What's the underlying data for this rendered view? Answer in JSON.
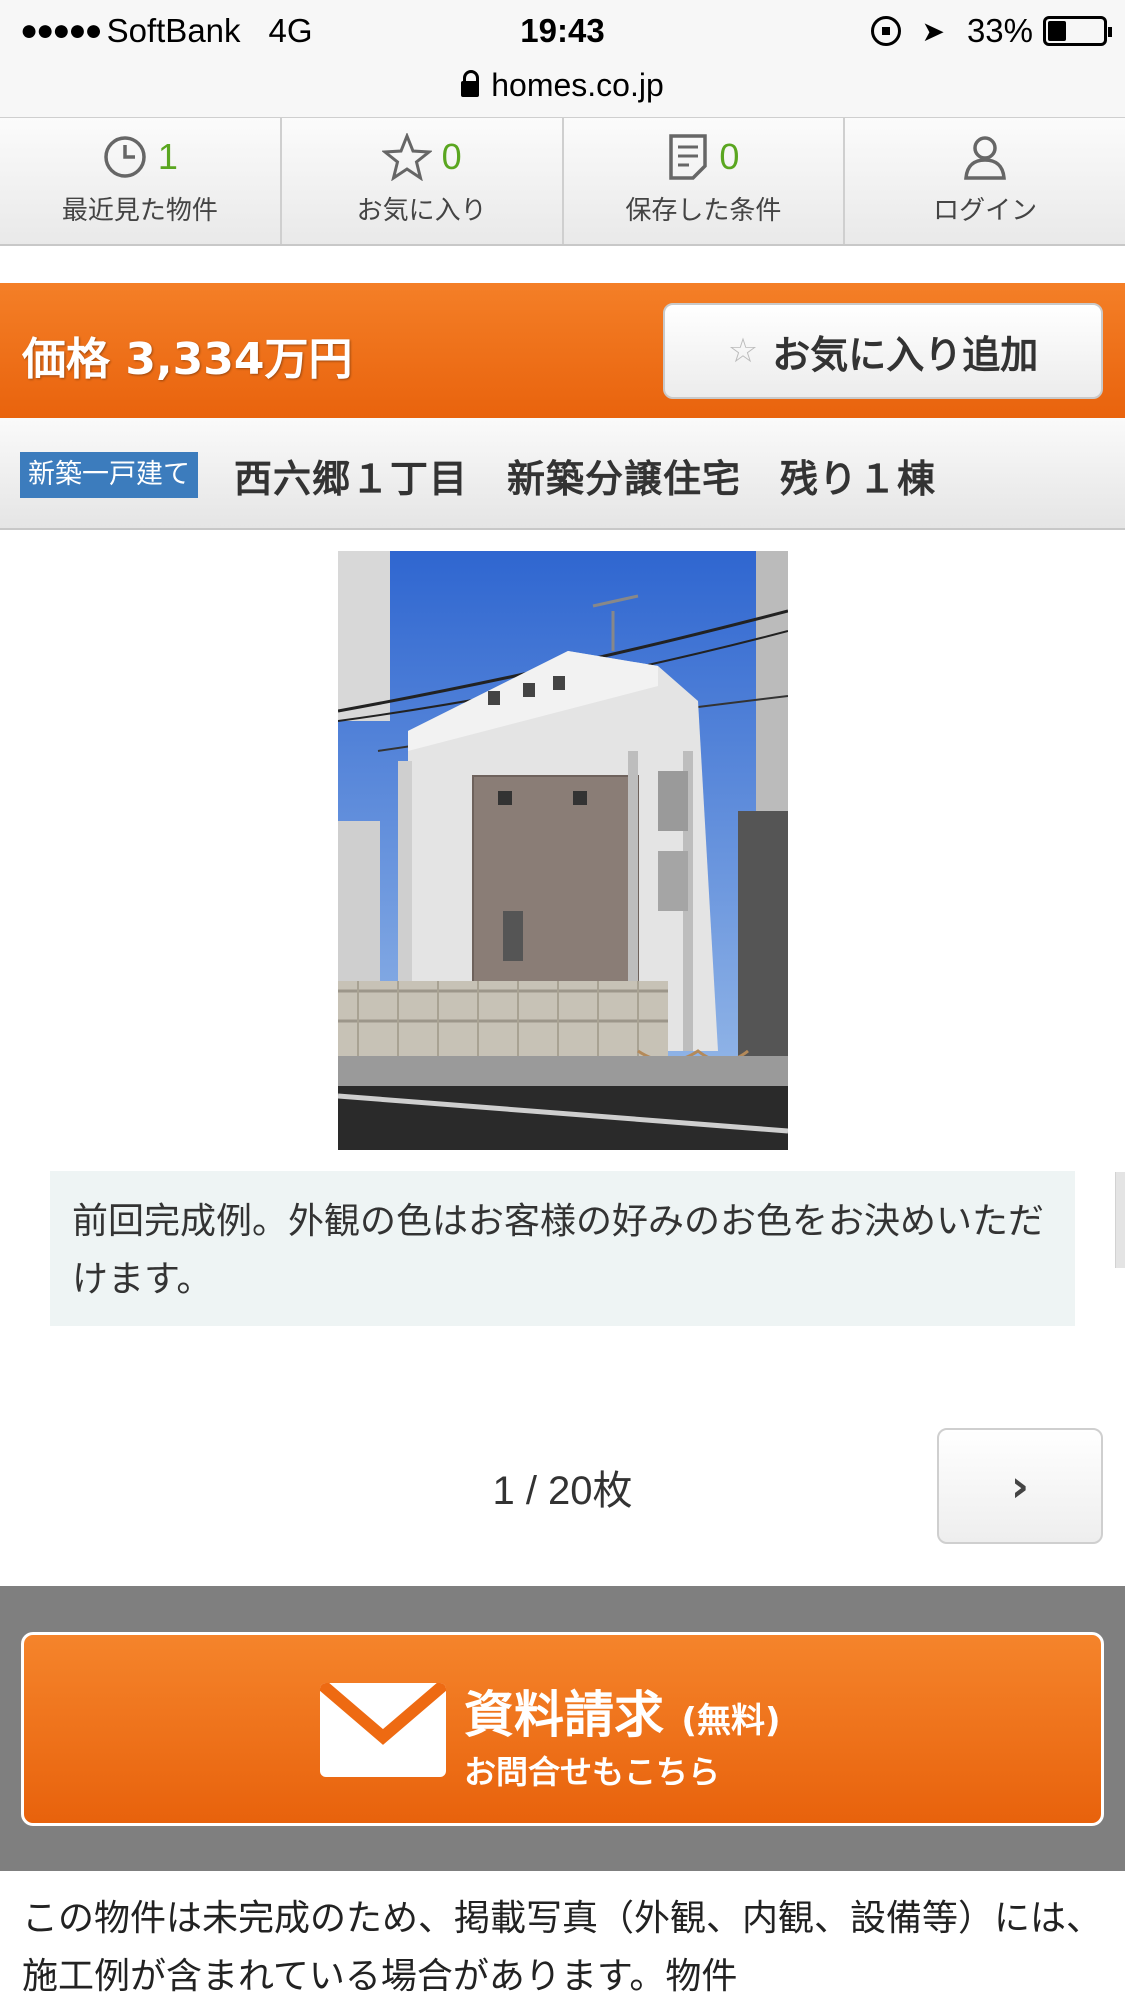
{
  "status_bar": {
    "signal": "●●●●●",
    "carrier": "SoftBank",
    "network": "4G",
    "time": "19:43",
    "battery": "33%",
    "battery_level": 0.33
  },
  "url_bar": {
    "url": "homes.co.jp"
  },
  "top_nav": [
    {
      "icon": "clock-icon",
      "count": "1",
      "label": "最近見た物件"
    },
    {
      "icon": "star-icon",
      "count": "0",
      "label": "お気に入り"
    },
    {
      "icon": "memo-icon",
      "count": "0",
      "label": "保存した条件"
    },
    {
      "icon": "user-icon",
      "count": "",
      "label": "ログイン"
    }
  ],
  "price": {
    "text": "価格 3,334万円",
    "favorite_label": "お気に入り追加"
  },
  "listing": {
    "type_badge": "新築一戸建て",
    "title": "西六郷１丁目　新築分譲住宅　残り１棟"
  },
  "photo": {
    "caption": "前回完成例。外観の色はお客様の好みのお色をお決めいただけます。",
    "pager": "1 / 20枚",
    "next_label": "›"
  },
  "contact": {
    "main": "資料請求",
    "free": "(無料)",
    "sub": "お問合せもこちら"
  },
  "note": "この物件は未完成のため、掲載写真（外観、内観、設備等）には、施工例が含まれている場合があります。物件",
  "colors": {
    "accent_orange": "#ee6f17",
    "badge_blue": "#3c7cbd",
    "count_green": "#5aa620"
  }
}
